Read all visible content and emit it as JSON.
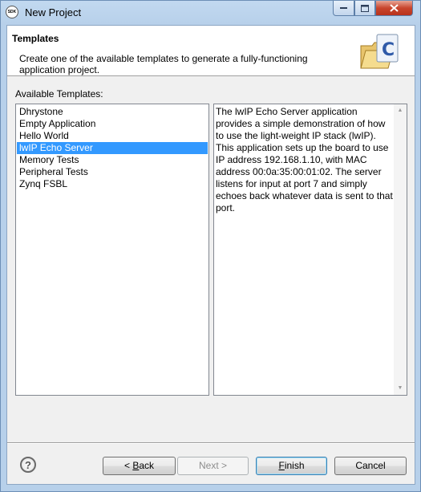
{
  "window": {
    "title": "New Project",
    "app_icon_text": "SDK"
  },
  "header": {
    "title": "Templates",
    "description": "Create one of the available templates to generate a fully-functioning application project."
  },
  "templates_label": "Available Templates:",
  "templates": [
    {
      "label": "Dhrystone",
      "selected": false
    },
    {
      "label": "Empty Application",
      "selected": false
    },
    {
      "label": "Hello World",
      "selected": false
    },
    {
      "label": "lwIP Echo Server",
      "selected": true
    },
    {
      "label": "Memory Tests",
      "selected": false
    },
    {
      "label": "Peripheral Tests",
      "selected": false
    },
    {
      "label": "Zynq FSBL",
      "selected": false
    }
  ],
  "template_description": "The lwIP Echo Server application provides a simple demonstration of how to use the light-weight IP stack (lwIP). This application sets up the board to use IP address 192.168.1.10, with MAC address 00:0a:35:00:01:02. The server listens for input at port 7 and simply echoes back whatever data is sent to that port.",
  "buttons": {
    "help": "?",
    "back_prefix": "< ",
    "back_mnemonic": "B",
    "back_rest": "ack",
    "next": "Next >",
    "finish_mnemonic": "F",
    "finish_rest": "inish",
    "cancel": "Cancel"
  },
  "colors": {
    "selection": "#3399ff",
    "title_bar": "#b7d0ea",
    "close_button": "#c8452d"
  }
}
